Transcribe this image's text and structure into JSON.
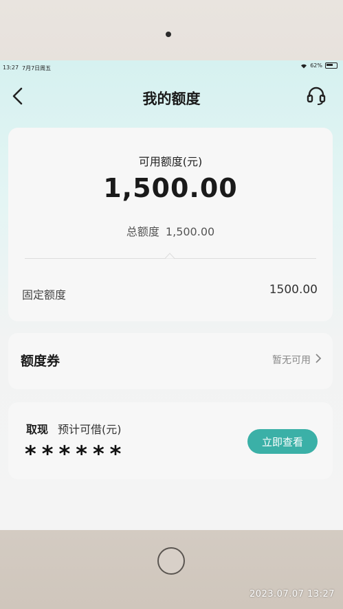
{
  "status_bar": {
    "time": "13:27",
    "date": "7月7日周五",
    "battery": "62%"
  },
  "nav": {
    "title": "我的额度"
  },
  "quota": {
    "available_label": "可用额度(元)",
    "available_amount": "1,500.00",
    "total_label": "总额度",
    "total_amount": "1,500.00",
    "fixed_label": "固定额度",
    "fixed_value": "1500.00"
  },
  "voucher": {
    "label": "额度券",
    "status": "暂无可用"
  },
  "cash": {
    "label": "取现",
    "sub_label": "预计可借(元)",
    "masked_amount": "******",
    "button_label": "立即查看"
  },
  "photo_timestamp": "2023.07.07   13:27",
  "colors": {
    "accent": "#3bb0a7",
    "screen_top": "#d6f1f0"
  }
}
